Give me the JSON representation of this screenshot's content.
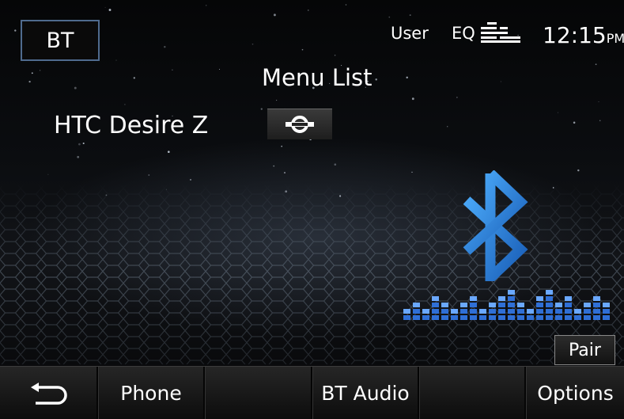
{
  "header": {
    "mode_label": "BT",
    "user_label": "User",
    "eq_label": "EQ",
    "time": "12:15",
    "ampm": "PM"
  },
  "main": {
    "title": "Menu List",
    "device_name": "HTC Desire Z"
  },
  "icons": {
    "link": "link-connection-icon",
    "bluetooth": "bluetooth-icon",
    "equalizer": "equalizer-icon",
    "back": "back-arrow-icon",
    "visualizer": "audio-visualizer"
  },
  "actions": {
    "pair_label": "Pair"
  },
  "bottom_bar": {
    "phone_label": "Phone",
    "bt_audio_label": "BT Audio",
    "options_label": "Options"
  },
  "colors": {
    "accent_blue": "#2f7fd6",
    "button_border": "#4f6b8e"
  }
}
